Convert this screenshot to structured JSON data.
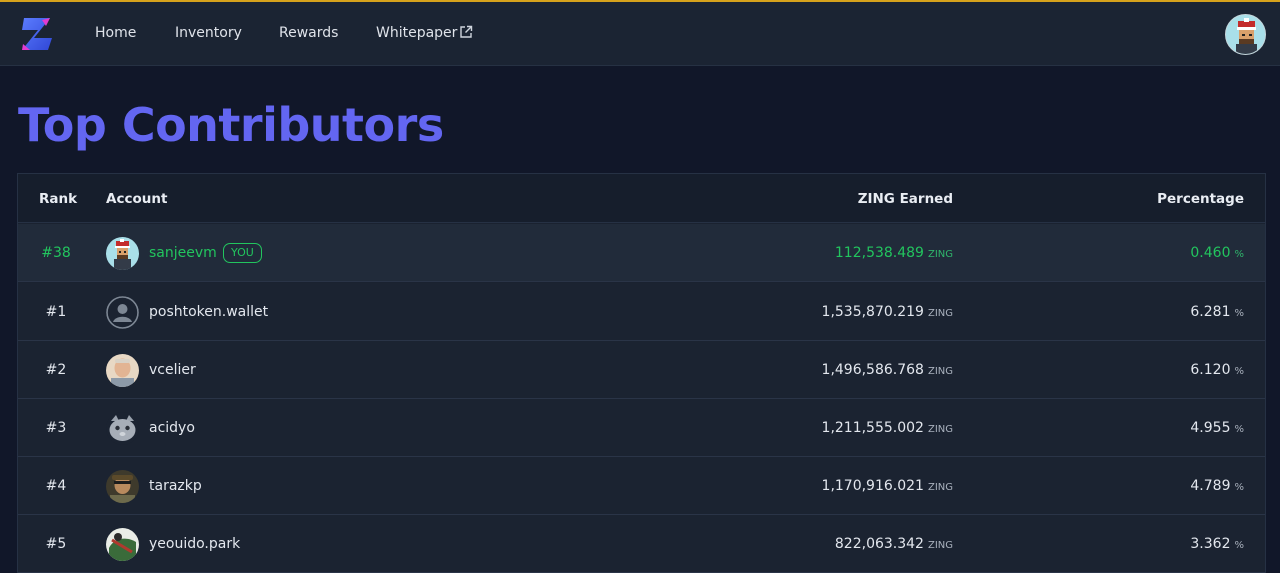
{
  "nav": {
    "links": [
      "Home",
      "Inventory",
      "Rewards",
      "Whitepaper"
    ]
  },
  "page": {
    "title": "Top Contributors"
  },
  "table": {
    "headers": {
      "rank": "Rank",
      "account": "Account",
      "earned": "ZING Earned",
      "percentage": "Percentage"
    },
    "current_user": {
      "rank": "#38",
      "account": "sanjeevm",
      "badge": "YOU",
      "earned": "112,538.489",
      "unit": "ZING",
      "percentage": "0.460",
      "pct_unit": "%"
    },
    "rows": [
      {
        "rank": "#1",
        "account": "poshtoken.wallet",
        "earned": "1,535,870.219",
        "unit": "ZING",
        "percentage": "6.281",
        "pct_unit": "%",
        "avatar_icon": "default-user-icon"
      },
      {
        "rank": "#2",
        "account": "vcelier",
        "earned": "1,496,586.768",
        "unit": "ZING",
        "percentage": "6.120",
        "pct_unit": "%",
        "avatar_icon": "photo-avatar"
      },
      {
        "rank": "#3",
        "account": "acidyo",
        "earned": "1,211,555.002",
        "unit": "ZING",
        "percentage": "4.955",
        "pct_unit": "%",
        "avatar_icon": "cat-avatar"
      },
      {
        "rank": "#4",
        "account": "tarazkp",
        "earned": "1,170,916.021",
        "unit": "ZING",
        "percentage": "4.789",
        "pct_unit": "%",
        "avatar_icon": "photo-avatar"
      },
      {
        "rank": "#5",
        "account": "yeouido.park",
        "earned": "822,063.342",
        "unit": "ZING",
        "percentage": "3.362",
        "pct_unit": "%",
        "avatar_icon": "photo-avatar"
      }
    ]
  },
  "colors": {
    "accent": "#6366f1",
    "highlight": "#22c55e",
    "background": "#111729",
    "navbar": "#1b2433",
    "top_border": "#d6a21c"
  }
}
